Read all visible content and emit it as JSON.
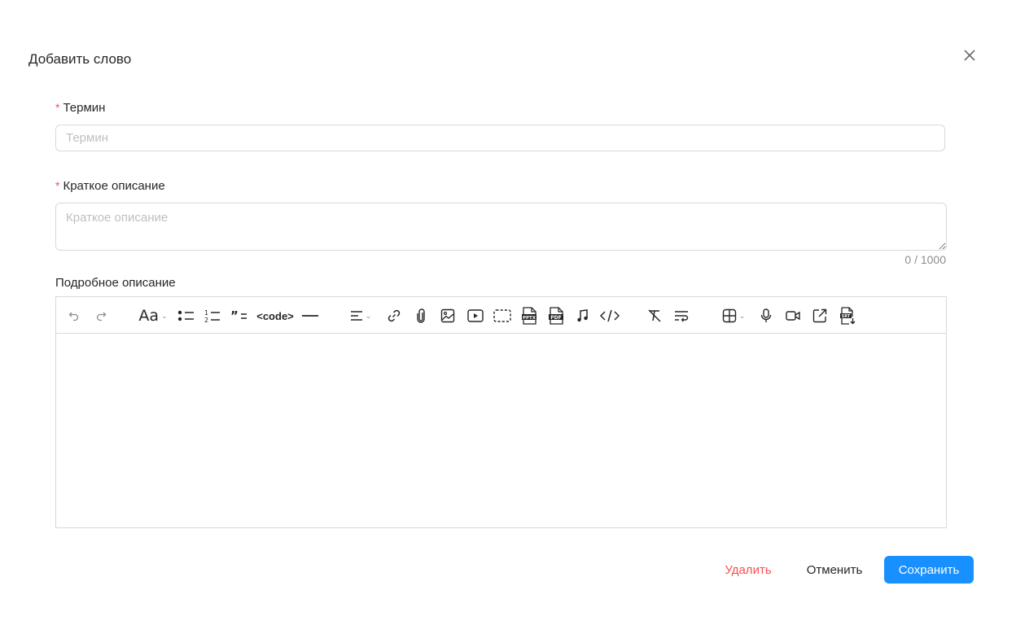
{
  "dialog": {
    "title": "Добавить слово"
  },
  "form": {
    "term": {
      "label": "Термин",
      "placeholder": "Термин",
      "value": ""
    },
    "short_description": {
      "label": "Краткое описание",
      "placeholder": "Краткое описание",
      "value": "",
      "counter": "0 / 1000"
    },
    "detailed_description": {
      "label": "Подробное описание"
    }
  },
  "toolbar": {
    "font_size_label": "Aa",
    "code_label": "<code>",
    "icons": [
      "undo-icon",
      "redo-icon",
      "font-size-icon",
      "bullet-list-icon",
      "numbered-list-icon",
      "blockquote-icon",
      "code-icon",
      "horizontal-rule-icon",
      "align-icon",
      "link-icon",
      "attachment-icon",
      "image-icon",
      "video-icon",
      "placeholder-block-icon",
      "pptx-icon",
      "pdf-icon",
      "audio-icon",
      "code-block-icon",
      "clear-format-icon",
      "text-wrap-icon",
      "table-icon",
      "microphone-icon",
      "camera-icon",
      "external-link-icon",
      "srt-icon"
    ]
  },
  "footer": {
    "delete_label": "Удалить",
    "cancel_label": "Отменить",
    "save_label": "Сохранить"
  },
  "colors": {
    "primary": "#1890ff",
    "danger": "#ff4d4f",
    "border": "#d9d9d9",
    "placeholder": "#bfbfbf"
  }
}
